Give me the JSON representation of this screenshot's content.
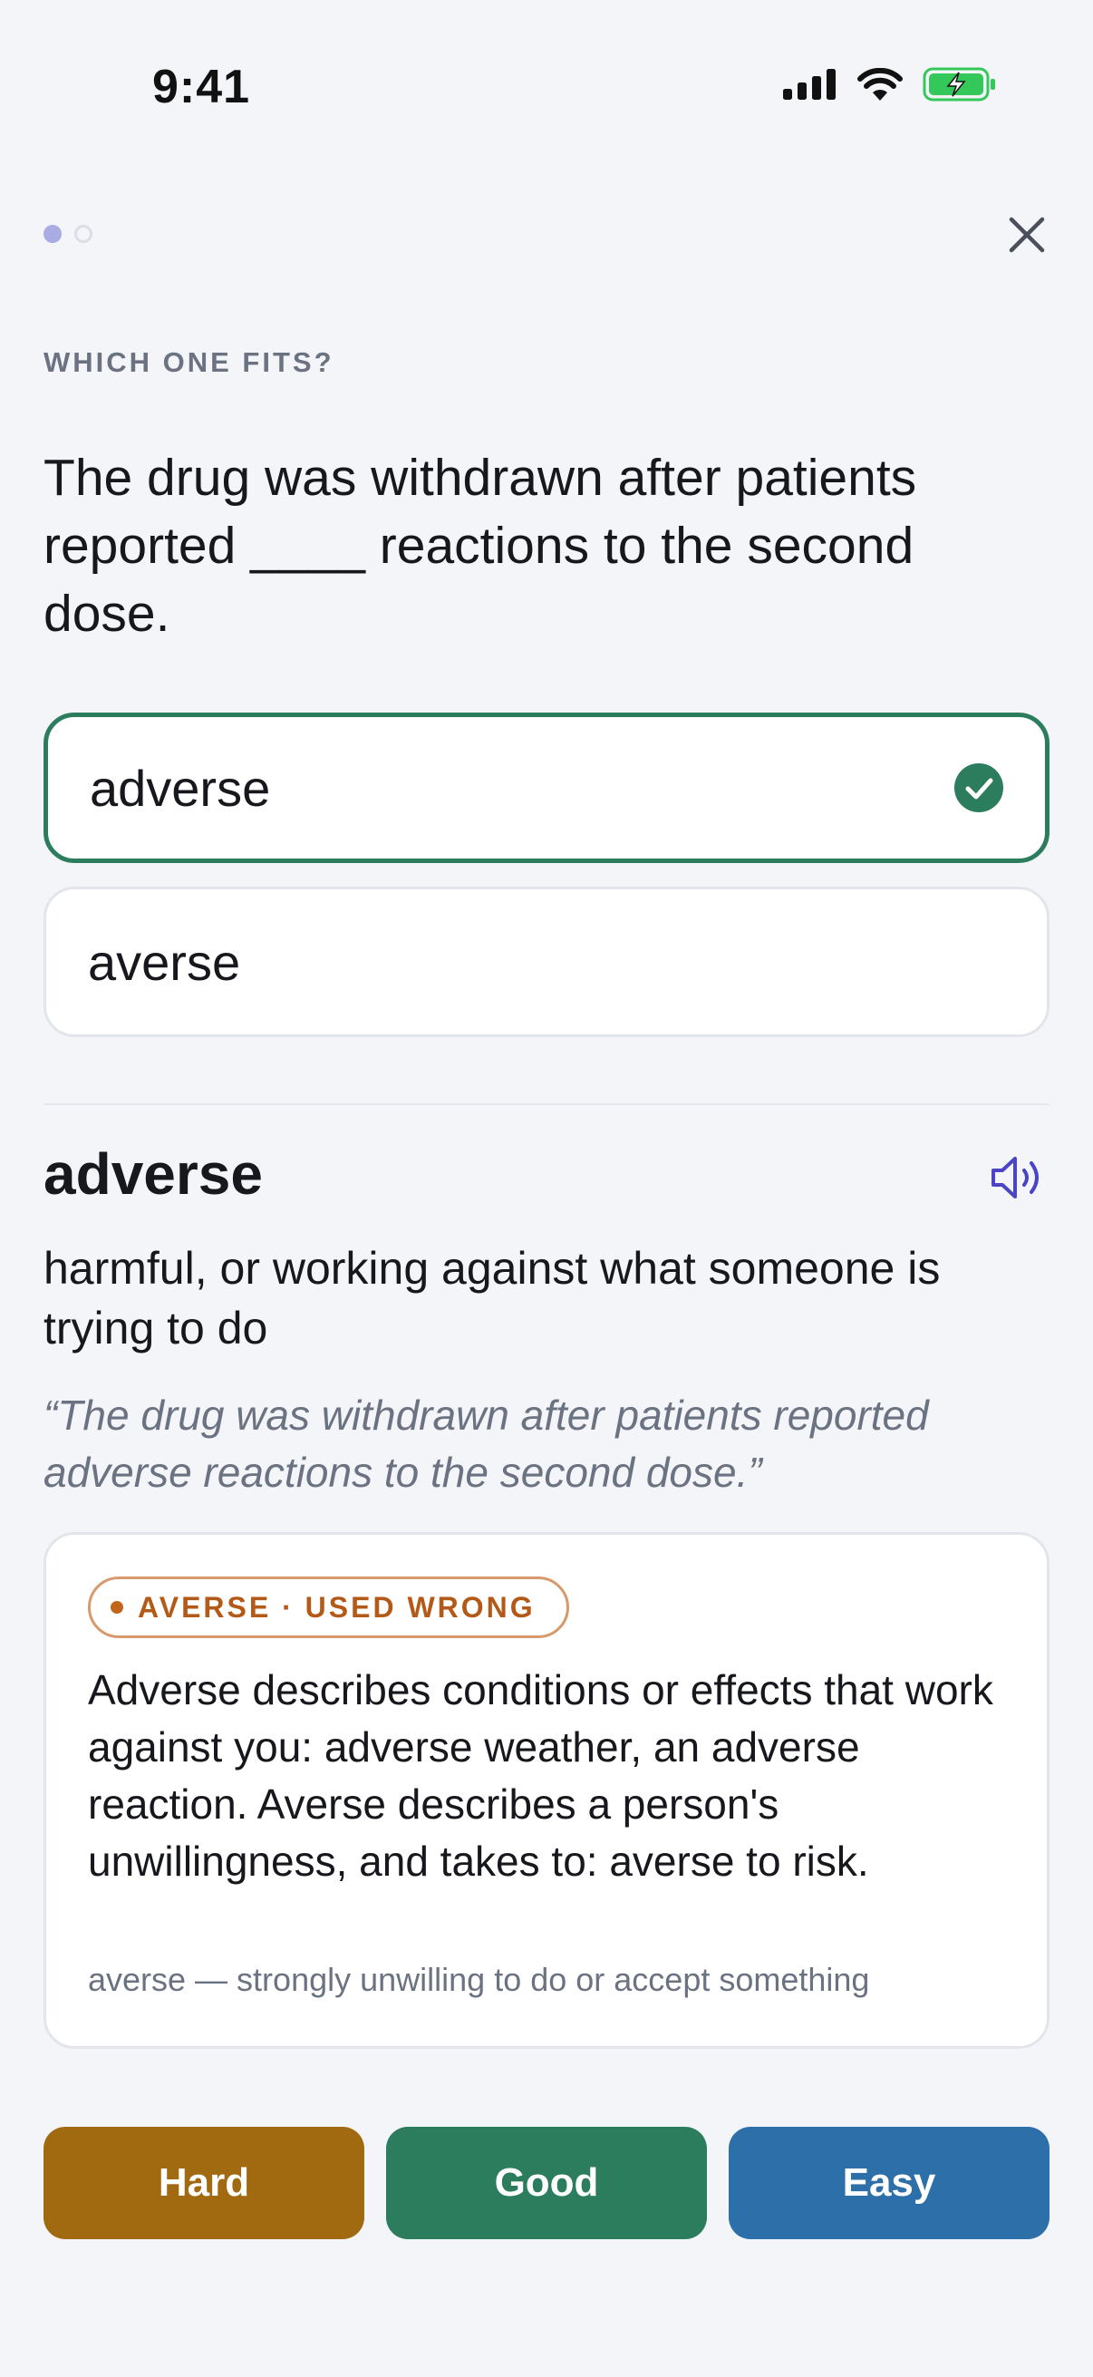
{
  "status_bar": {
    "time": "9:41",
    "icons": [
      "signal-icon",
      "wifi-icon",
      "battery-charging-icon"
    ]
  },
  "progress": {
    "total": 2,
    "current": 1
  },
  "prompt_label": "WHICH ONE FITS?",
  "question": "The drug was withdrawn after patients reported ____ reactions to the second dose.",
  "options": [
    {
      "label": "adverse",
      "state": "correct"
    },
    {
      "label": "averse",
      "state": "neutral"
    }
  ],
  "answer": {
    "word": "adverse",
    "definition": "harmful, or working against what someone is trying to do",
    "example": "“The drug was withdrawn after patients reported adverse reactions to the second dose.”"
  },
  "note": {
    "badge": "AVERSE · USED WRONG",
    "body": "Adverse describes conditions or effects that work against you: adverse weather, an adverse reaction. Averse describes a person's unwillingness, and takes to: averse to risk.",
    "footer": "averse — strongly unwilling to do or accept something"
  },
  "ratings": {
    "hard": "Hard",
    "good": "Good",
    "easy": "Easy"
  },
  "colors": {
    "accent_correct": "#2c7d5e",
    "accent_brand": "#4b45c4",
    "warning": "#b45a18",
    "hard": "#a26a10",
    "good": "#2c7d5e",
    "easy": "#2d6fa8"
  }
}
